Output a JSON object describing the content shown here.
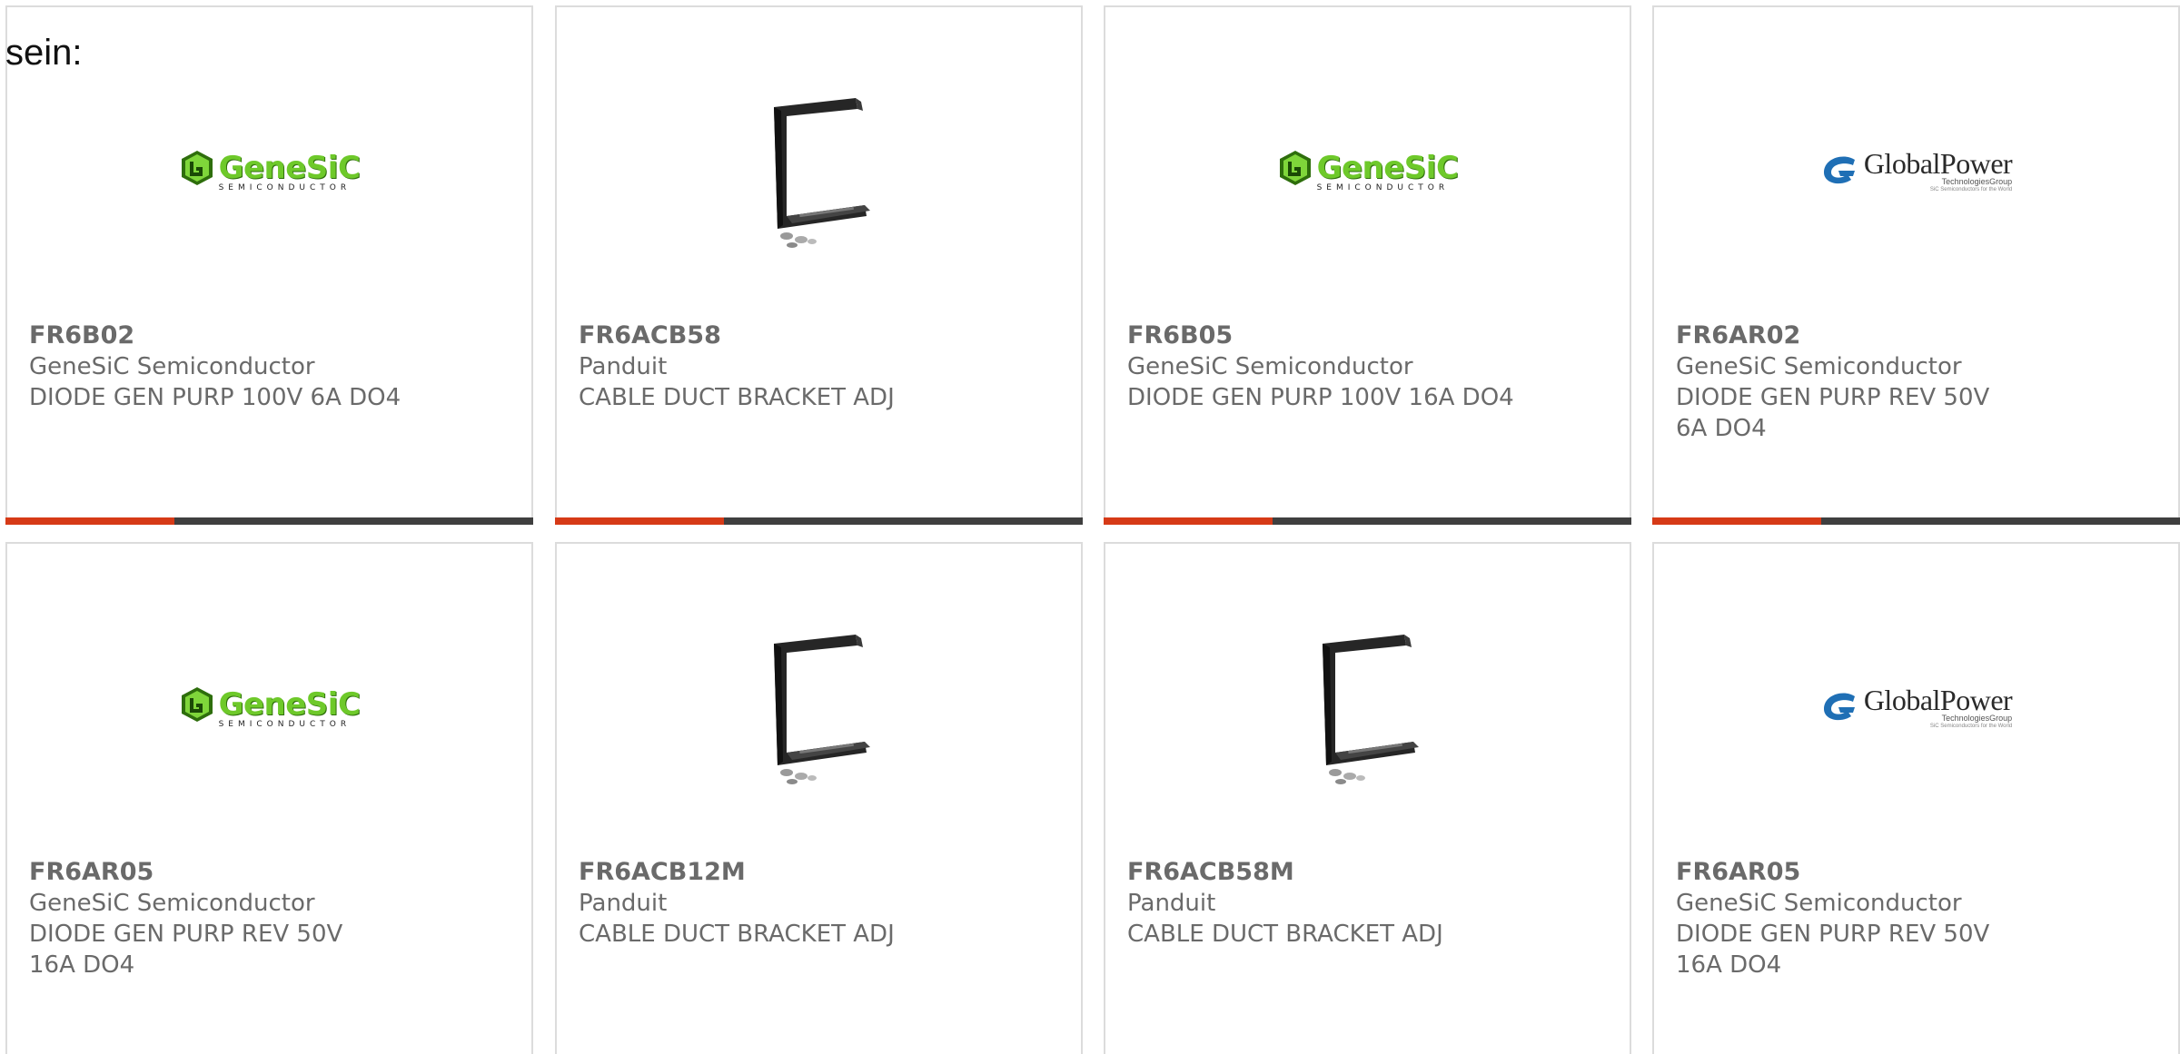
{
  "lead_text": "sein:",
  "colors": {
    "accent_orange": "#d63a17",
    "accent_dark": "#3f3f3f",
    "card_border": "#dcdcdc",
    "text_gray": "#6a6a6a",
    "genesic_green": "#6ec92a",
    "globalpower_blue": "#1f6fb5"
  },
  "logos": {
    "genesic": {
      "word": "GeneSiC",
      "sub": "SEMICONDUCTOR"
    },
    "globalpower": {
      "word": "GlobalPower",
      "sub": "TechnologiesGroup",
      "sub2": "SiC Semiconductors for the World"
    }
  },
  "products": [
    {
      "part": "FR6B02",
      "manufacturer": "GeneSiC Semiconductor",
      "description": "DIODE GEN PURP 100V 6A DO4",
      "image": "genesic-logo"
    },
    {
      "part": "FR6ACB58",
      "manufacturer": "Panduit",
      "description": "CABLE DUCT BRACKET ADJ",
      "image": "cable-duct-bracket"
    },
    {
      "part": "FR6B05",
      "manufacturer": "GeneSiC Semiconductor",
      "description": "DIODE GEN PURP 100V 16A DO4",
      "image": "genesic-logo"
    },
    {
      "part": "FR6AR02",
      "manufacturer": "GeneSiC Semiconductor",
      "description": "DIODE GEN PURP REV 50V 6A DO4",
      "image": "globalpower-logo"
    },
    {
      "part": "FR6AR05",
      "manufacturer": "GeneSiC Semiconductor",
      "description": "DIODE GEN PURP REV 50V 16A DO4",
      "image": "genesic-logo"
    },
    {
      "part": "FR6ACB12M",
      "manufacturer": "Panduit",
      "description": "CABLE DUCT BRACKET ADJ",
      "image": "cable-duct-bracket"
    },
    {
      "part": "FR6ACB58M",
      "manufacturer": "Panduit",
      "description": "CABLE DUCT BRACKET ADJ",
      "image": "cable-duct-bracket"
    },
    {
      "part": "FR6AR05",
      "manufacturer": "GeneSiC Semiconductor",
      "description": "DIODE GEN PURP REV 50V 16A DO4",
      "image": "globalpower-logo"
    }
  ]
}
